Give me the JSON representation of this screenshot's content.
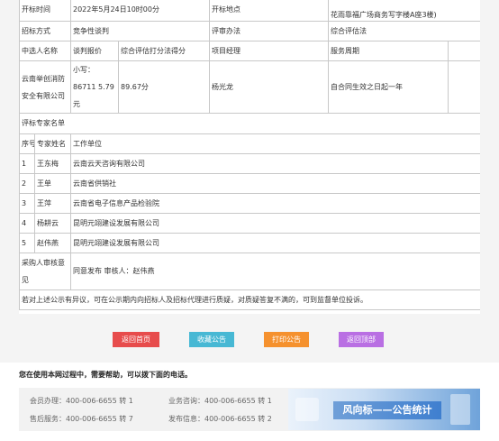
{
  "table": {
    "row1": {
      "open_time_label": "开标时间",
      "open_time_value": "2022年5月24日10时00分",
      "open_place_label": "开标地点",
      "open_place_value": "花雨靠福广场商务写字楼A座3楼)"
    },
    "row2": {
      "method_label": "招标方式",
      "method_value": "竞争性谈判",
      "eval_label": "评审办法",
      "eval_value": "综合评估法"
    },
    "row3": {
      "c1": "中选人名称",
      "c2": "谈判报价",
      "c3": "综合评估打分法得分",
      "c4": "项目经理",
      "c5": "服务周期"
    },
    "row4": {
      "name": "云南举创消防安全有限公司",
      "price": "小写：86711 5.79元",
      "score": "89.67分",
      "manager": "杨光龙",
      "period": "自合同生效之日起一年"
    },
    "experts_title": "评标专家名单",
    "experts_header": {
      "no": "序号",
      "name": "专家姓名",
      "unit": "工作单位"
    },
    "experts": [
      {
        "no": "1",
        "name": "王东梅",
        "unit": "云南云天咨询有限公司"
      },
      {
        "no": "2",
        "name": "王单",
        "unit": "云南省供销社"
      },
      {
        "no": "3",
        "name": "王萍",
        "unit": "云南省电子信息产品检验院"
      },
      {
        "no": "4",
        "name": "杨耕云",
        "unit": "昆明元翊建设发展有限公司"
      },
      {
        "no": "5",
        "name": "赵伟燕",
        "unit": "昆明元翊建设发展有限公司"
      }
    ],
    "purchaser_label": "采购人审核意见",
    "purchaser_value": "同意发布 审核人：赵伟燕",
    "notice": "若对上述公示有异议，可在公示期内向招标人及招标代理进行质疑，对质疑答复不满的，可到监督单位投诉。"
  },
  "buttons": {
    "home": "返回首页",
    "favorite": "收藏公告",
    "print": "打印公告",
    "top": "返回顶部"
  },
  "colors": {
    "home": "#e74c4c",
    "favorite": "#47b8d4",
    "print": "#f5912e",
    "top": "#b96fe3"
  },
  "footer": {
    "help_title": "您在使用本网过程中，需要帮助，可以拨下面的电话。",
    "member": "会员办理：400-006-6655 转 1",
    "business": "业务咨询：400-006-6655 转 1",
    "aftersale": "售后服务：400-006-6655 转 7",
    "publish": "发布信息：400-006-6655 转 2",
    "banner_text": "风向标——公告统计"
  }
}
